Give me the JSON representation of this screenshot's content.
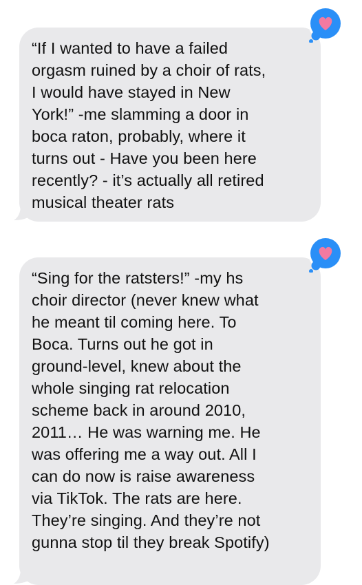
{
  "messages": [
    {
      "lines": [
        "“If I wanted to have a failed",
        "orgasm ruined by a choir of rats,",
        "I would have stayed in New",
        "York!” -me slamming a door in",
        "boca raton, probably, where it",
        "turns out - Have you been here",
        "recently? - it’s actually all retired",
        "musical theater rats"
      ],
      "reaction": "heart-icon"
    },
    {
      "lines": [
        "“Sing for the ratsters!” -my hs",
        "choir director (never knew what",
        "he meant til coming here. To",
        "Boca. Turns out he got in",
        "ground-level, knew about the",
        "whole singing rat relocation",
        "scheme back in around 2010,",
        "2011… He was warning me. He",
        "was offering me a way out. All I",
        "can do now is raise awareness",
        "via TikTok. The rats are here.",
        "They’re singing. And they’re not",
        "gunna stop til they break Spotify)"
      ],
      "reaction": "heart-icon"
    }
  ],
  "colors": {
    "bubble": "#e9e9eb",
    "text": "#111111",
    "reaction_bg": "#2a8ff7",
    "heart": "#f27aa1"
  }
}
